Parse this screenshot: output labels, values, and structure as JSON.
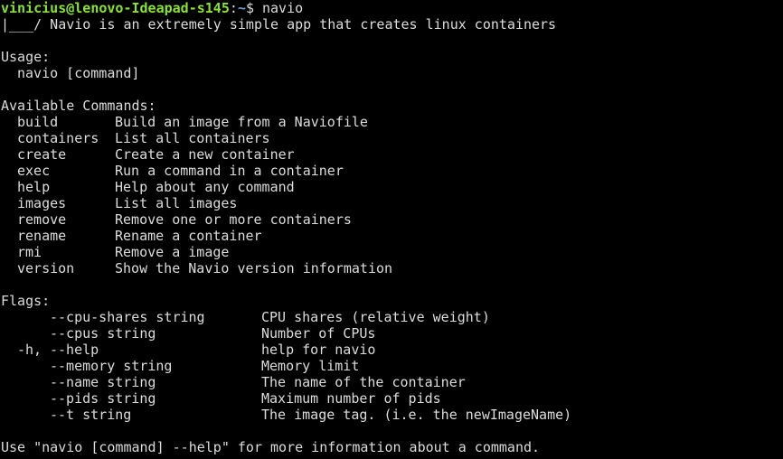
{
  "prompt": {
    "user_host": "vinicius@lenovo-Ideapad-s145",
    "separator": ":",
    "path": "~",
    "symbol": "$ ",
    "command": "navio"
  },
  "banner": "|___/ Navio is an extremely simple app that creates linux containers",
  "usage": {
    "heading": "Usage:",
    "syntax": "navio [command]"
  },
  "commands": {
    "heading": "Available Commands:",
    "items": [
      {
        "name": "build",
        "desc": "Build an image from a Naviofile"
      },
      {
        "name": "containers",
        "desc": "List all containers"
      },
      {
        "name": "create",
        "desc": "Create a new container"
      },
      {
        "name": "exec",
        "desc": "Run a command in a container"
      },
      {
        "name": "help",
        "desc": "Help about any command"
      },
      {
        "name": "images",
        "desc": "List all images"
      },
      {
        "name": "remove",
        "desc": "Remove one or more containers"
      },
      {
        "name": "rename",
        "desc": "Rename a container"
      },
      {
        "name": "rmi",
        "desc": "Remove a image"
      },
      {
        "name": "version",
        "desc": "Show the Navio version information"
      }
    ]
  },
  "flags": {
    "heading": "Flags:",
    "items": [
      {
        "short": "",
        "name": "--cpu-shares string",
        "desc": "CPU shares (relative weight)"
      },
      {
        "short": "",
        "name": "--cpus string",
        "desc": "Number of CPUs"
      },
      {
        "short": "-h, ",
        "name": "--help",
        "desc": "help for navio"
      },
      {
        "short": "",
        "name": "--memory string",
        "desc": "Memory limit"
      },
      {
        "short": "",
        "name": "--name string",
        "desc": "The name of the container"
      },
      {
        "short": "",
        "name": "--pids string",
        "desc": "Maximum number of pids"
      },
      {
        "short": "",
        "name": "--t string",
        "desc": "The image tag. (i.e. the newImageName)"
      }
    ]
  },
  "footer": "Use \"navio [command] --help\" for more information about a command.",
  "colors": {
    "background": "#000000",
    "text": "#dcdcdc",
    "user_host": "#8ae234",
    "path": "#729fcf"
  }
}
